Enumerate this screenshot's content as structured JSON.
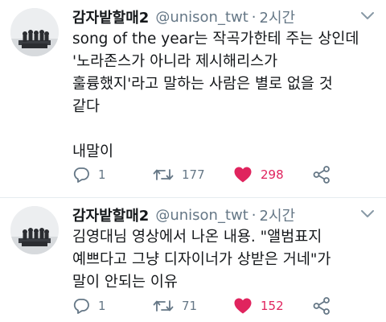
{
  "tweets": [
    {
      "display_name": "감자밭할매2",
      "handle": "@unison_twt",
      "separator": "·",
      "time": "2시간",
      "body_lines": [
        "song of the year는 작곡가한테 주는 상인데",
        "'노라존스가 아니라 제시해리스가",
        "훌륭했지'라고 말하는 사람은 별로 없을 것",
        "같다",
        "",
        "내말이"
      ],
      "replies": "1",
      "retweets": "177",
      "likes": "298",
      "liked": true
    },
    {
      "display_name": "감자밭할매2",
      "handle": "@unison_twt",
      "separator": "·",
      "time": "2시간",
      "body_lines": [
        "김영대님 영상에서 나온 내용. \"앨범표지",
        "예쁘다고 그냥 디자이너가 상받은 거네\"가",
        "말이 안되는 이유"
      ],
      "replies": "1",
      "retweets": "71",
      "likes": "152",
      "liked": true
    }
  ],
  "colors": {
    "text": "#14171a",
    "muted": "#657786",
    "like": "#e0245e",
    "divider": "#e6ecf0"
  },
  "icons": [
    "reply-icon",
    "retweet-icon",
    "heart-icon",
    "share-icon",
    "chevron-down-icon"
  ]
}
